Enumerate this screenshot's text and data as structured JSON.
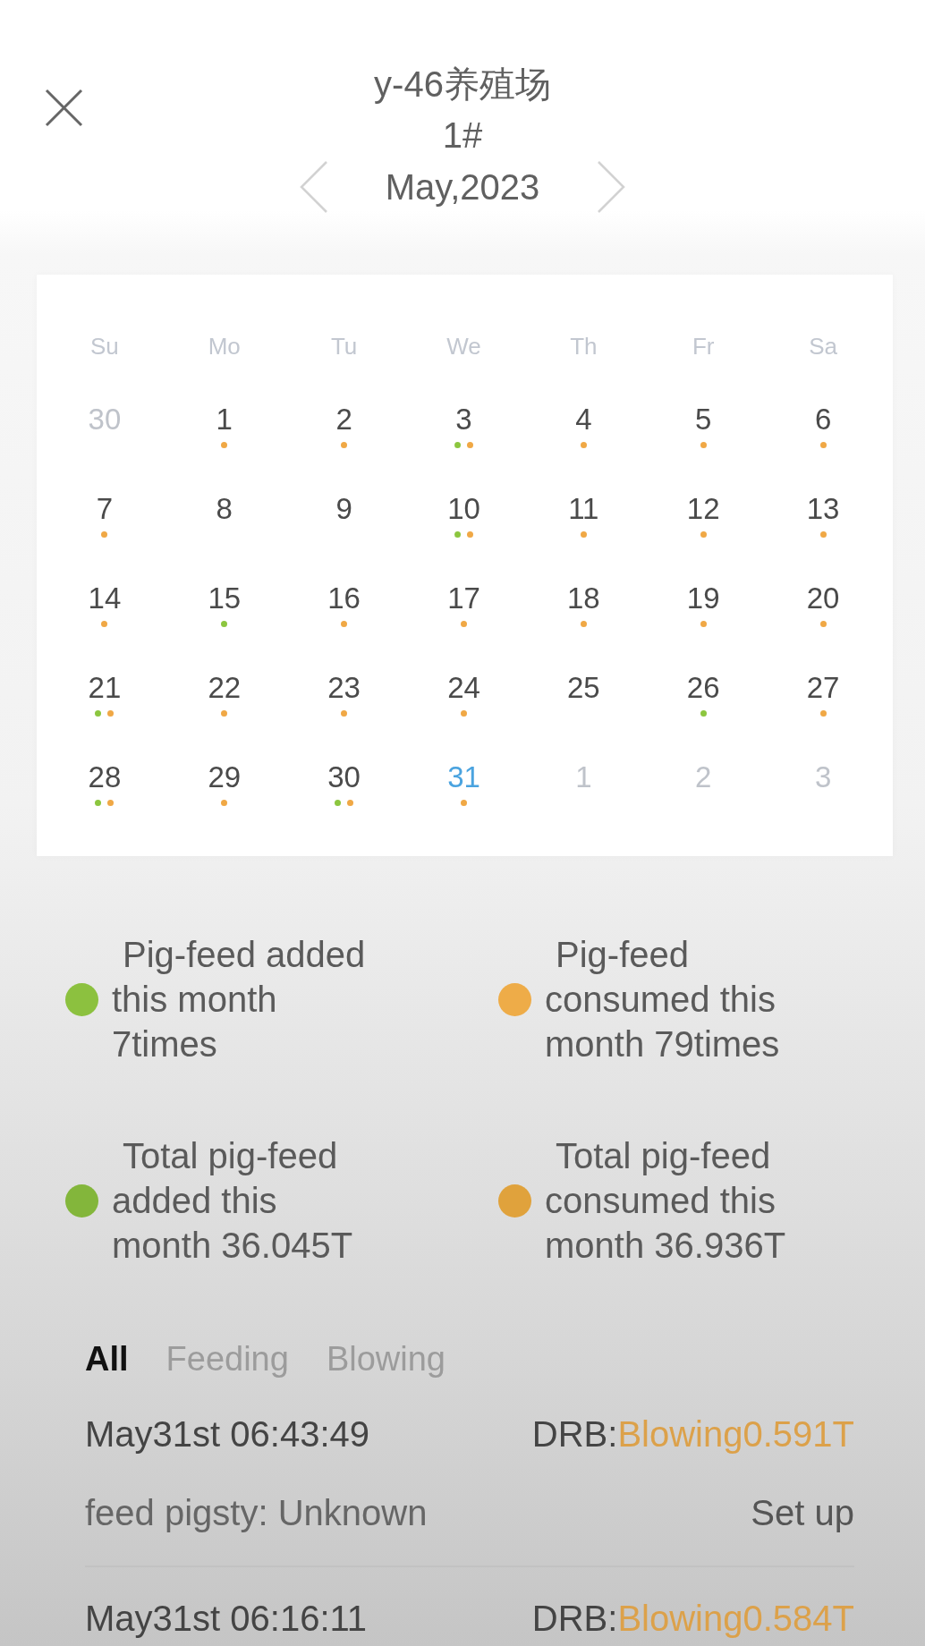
{
  "header": {
    "title": "y-46养殖场",
    "subtitle": "1#",
    "month": "May,2023"
  },
  "calendar": {
    "weekdays": [
      "Su",
      "Mo",
      "Tu",
      "We",
      "Th",
      "Fr",
      "Sa"
    ],
    "days": [
      {
        "day": "30",
        "muted": true,
        "today": false,
        "added": false,
        "consumed": false
      },
      {
        "day": "1",
        "muted": false,
        "today": false,
        "added": false,
        "consumed": true
      },
      {
        "day": "2",
        "muted": false,
        "today": false,
        "added": false,
        "consumed": true
      },
      {
        "day": "3",
        "muted": false,
        "today": false,
        "added": true,
        "consumed": true
      },
      {
        "day": "4",
        "muted": false,
        "today": false,
        "added": false,
        "consumed": true
      },
      {
        "day": "5",
        "muted": false,
        "today": false,
        "added": false,
        "consumed": true
      },
      {
        "day": "6",
        "muted": false,
        "today": false,
        "added": false,
        "consumed": true
      },
      {
        "day": "7",
        "muted": false,
        "today": false,
        "added": false,
        "consumed": true
      },
      {
        "day": "8",
        "muted": false,
        "today": false,
        "added": false,
        "consumed": false
      },
      {
        "day": "9",
        "muted": false,
        "today": false,
        "added": false,
        "consumed": false
      },
      {
        "day": "10",
        "muted": false,
        "today": false,
        "added": true,
        "consumed": true
      },
      {
        "day": "11",
        "muted": false,
        "today": false,
        "added": false,
        "consumed": true
      },
      {
        "day": "12",
        "muted": false,
        "today": false,
        "added": false,
        "consumed": true
      },
      {
        "day": "13",
        "muted": false,
        "today": false,
        "added": false,
        "consumed": true
      },
      {
        "day": "14",
        "muted": false,
        "today": false,
        "added": false,
        "consumed": true
      },
      {
        "day": "15",
        "muted": false,
        "today": false,
        "added": true,
        "consumed": false
      },
      {
        "day": "16",
        "muted": false,
        "today": false,
        "added": false,
        "consumed": true
      },
      {
        "day": "17",
        "muted": false,
        "today": false,
        "added": false,
        "consumed": true
      },
      {
        "day": "18",
        "muted": false,
        "today": false,
        "added": false,
        "consumed": true
      },
      {
        "day": "19",
        "muted": false,
        "today": false,
        "added": false,
        "consumed": true
      },
      {
        "day": "20",
        "muted": false,
        "today": false,
        "added": false,
        "consumed": true
      },
      {
        "day": "21",
        "muted": false,
        "today": false,
        "added": true,
        "consumed": true
      },
      {
        "day": "22",
        "muted": false,
        "today": false,
        "added": false,
        "consumed": true
      },
      {
        "day": "23",
        "muted": false,
        "today": false,
        "added": false,
        "consumed": true
      },
      {
        "day": "24",
        "muted": false,
        "today": false,
        "added": false,
        "consumed": true
      },
      {
        "day": "25",
        "muted": false,
        "today": false,
        "added": false,
        "consumed": false
      },
      {
        "day": "26",
        "muted": false,
        "today": false,
        "added": true,
        "consumed": false
      },
      {
        "day": "27",
        "muted": false,
        "today": false,
        "added": false,
        "consumed": true
      },
      {
        "day": "28",
        "muted": false,
        "today": false,
        "added": true,
        "consumed": true
      },
      {
        "day": "29",
        "muted": false,
        "today": false,
        "added": false,
        "consumed": true
      },
      {
        "day": "30",
        "muted": false,
        "today": false,
        "added": true,
        "consumed": true
      },
      {
        "day": "31",
        "muted": false,
        "today": true,
        "added": false,
        "consumed": true
      },
      {
        "day": "1",
        "muted": true,
        "today": false,
        "added": false,
        "consumed": false
      },
      {
        "day": "2",
        "muted": true,
        "today": false,
        "added": false,
        "consumed": false
      },
      {
        "day": "3",
        "muted": true,
        "today": false,
        "added": false,
        "consumed": false
      }
    ]
  },
  "legend": [
    {
      "text": "Pig-feed added this month 7times",
      "color": "#8cc13f"
    },
    {
      "text": "Pig-feed consumed this month 79times",
      "color": "#eeac48"
    },
    {
      "text": "Total pig-feed added this month 36.045T",
      "color": "#83b63b"
    },
    {
      "text": "Total pig-feed consumed this month 36.936T",
      "color": "#e0a23c"
    }
  ],
  "tabs": [
    {
      "label": "All",
      "selected": true
    },
    {
      "label": "Feeding",
      "selected": false
    },
    {
      "label": "Blowing",
      "selected": false
    }
  ],
  "records": [
    {
      "time": "May31st 06:43:49",
      "device": "DRB:",
      "amount": "Blowing0.591T",
      "pigsty": "feed pigsty: Unknown",
      "action": "Set up"
    },
    {
      "time": "May31st 06:16:11",
      "device": "DRB:",
      "amount": "Blowing0.584T"
    }
  ]
}
